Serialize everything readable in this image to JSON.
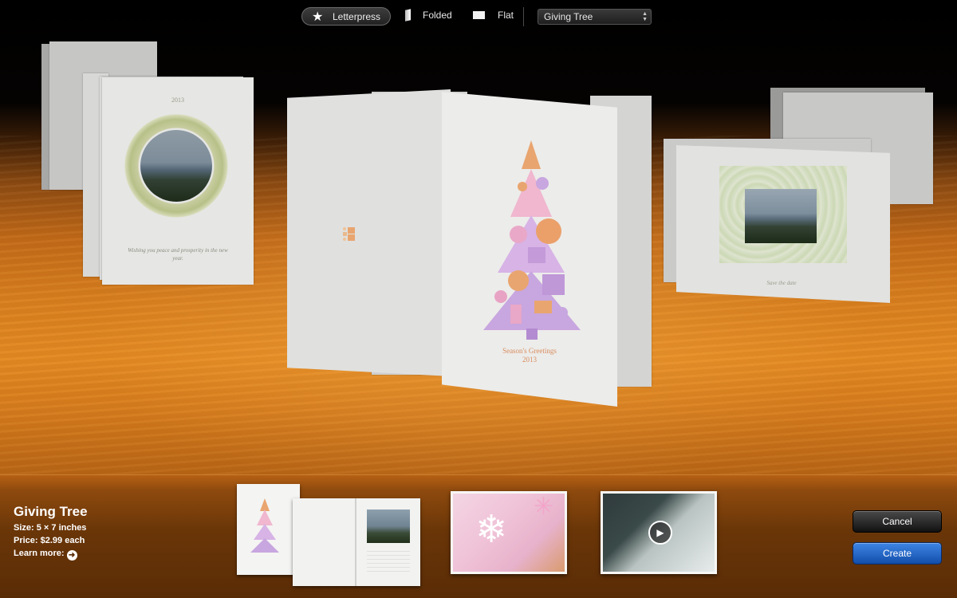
{
  "toolbar": {
    "styles": [
      {
        "label": "Letterpress",
        "icon": "star-icon",
        "selected": true
      },
      {
        "label": "Folded",
        "icon": "folded-card-icon",
        "selected": false
      },
      {
        "label": "Flat",
        "icon": "flat-card-icon",
        "selected": false
      }
    ],
    "theme_select": {
      "value": "Giving Tree"
    }
  },
  "cards": {
    "left": {
      "year": "2013",
      "message": "Wishing you peace and prosperity in the new year."
    },
    "center": {
      "line1": "Season's Greetings",
      "line2": "2013"
    },
    "right": {
      "message": "Save the date"
    }
  },
  "info": {
    "name": "Giving Tree",
    "size_label": "Size:",
    "size_value": "5 × 7 inches",
    "price_label": "Price:",
    "price_value": "$2.99 each",
    "learn_more": "Learn more:"
  },
  "buttons": {
    "cancel": "Cancel",
    "create": "Create"
  },
  "colors": {
    "accent_blue": "#2a6fd3",
    "tree_orange": "#e9a56f",
    "tree_purple": "#c7a6dd",
    "tree_pink": "#f0a9c6"
  }
}
